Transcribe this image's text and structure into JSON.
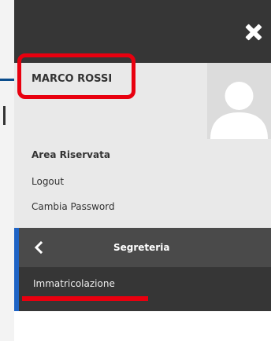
{
  "user": {
    "name": "MARCO ROSSI"
  },
  "account_menu": {
    "heading": "Area Riservata",
    "logout_label": "Logout",
    "change_password_label": "Cambia Password"
  },
  "section": {
    "title": "Segreteria",
    "items": [
      {
        "label": "Immatricolazione"
      }
    ]
  },
  "icons": {
    "close": "close-icon",
    "back": "chevron-left-icon",
    "avatar": "user-silhouette-icon"
  },
  "colors": {
    "header_bg": "#363636",
    "user_area_bg": "#e9e9e9",
    "section_header_bg": "#4a4a4a",
    "accent_blue": "#1e63c5",
    "annotation_red": "#e8000f"
  }
}
